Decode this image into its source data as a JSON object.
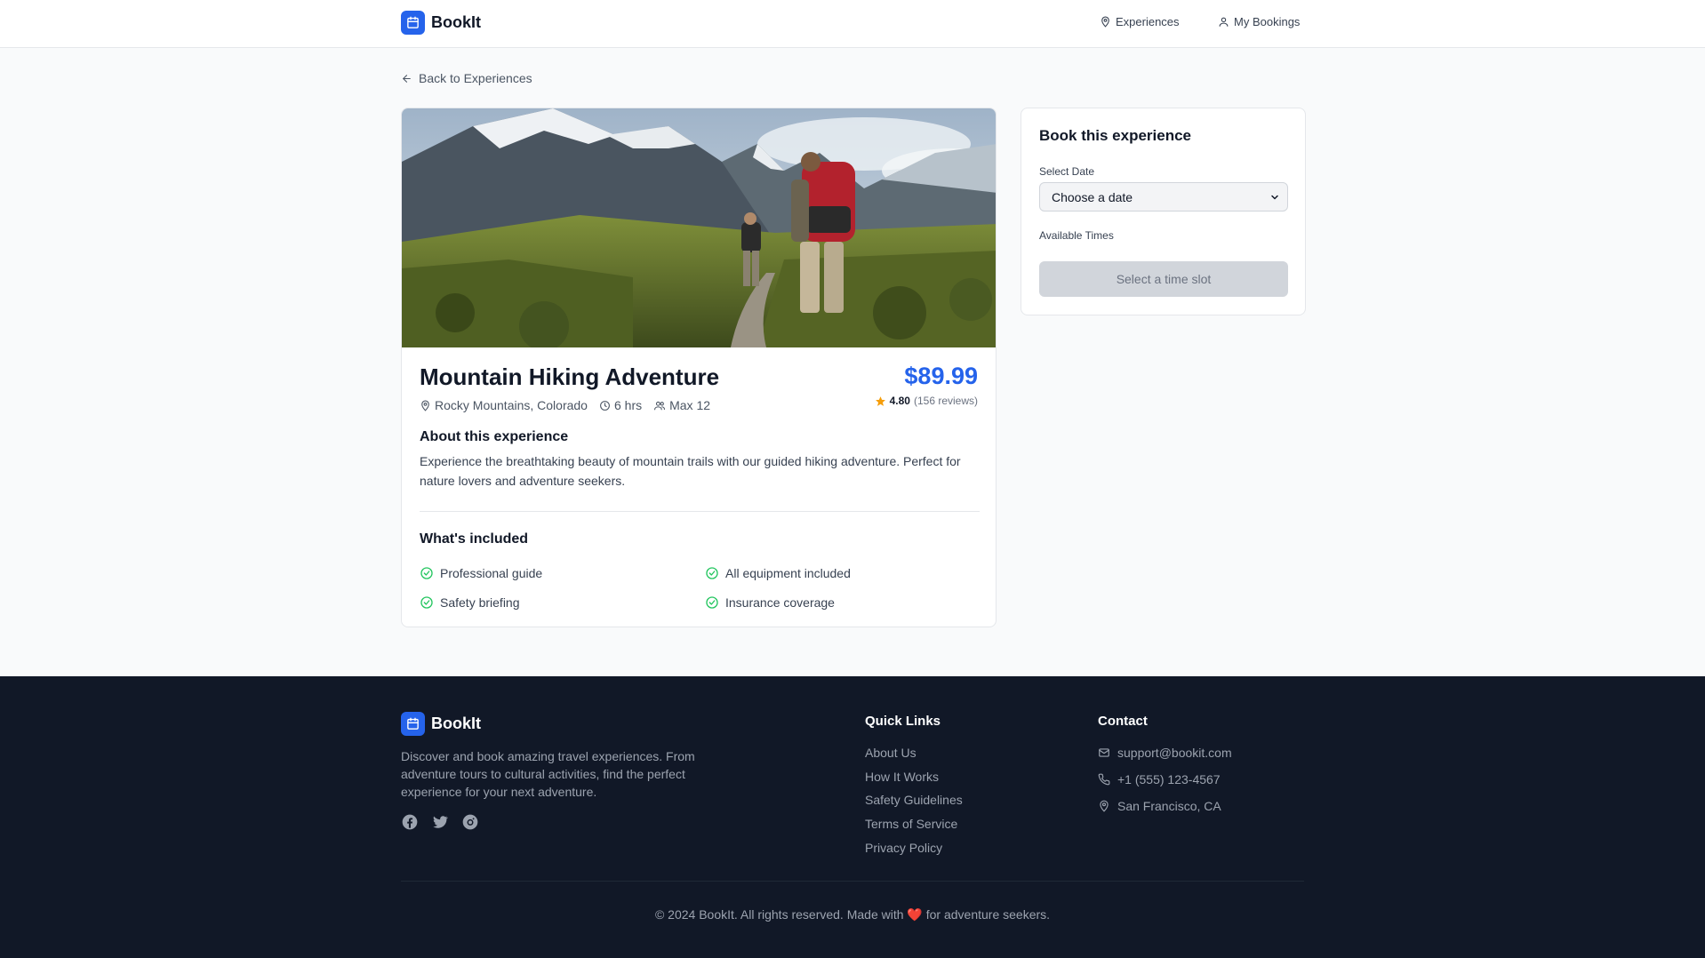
{
  "header": {
    "brand": "BookIt",
    "nav": [
      {
        "label": "Experiences",
        "icon": "map-pin-icon"
      },
      {
        "label": "My Bookings",
        "icon": "user-icon"
      }
    ]
  },
  "back_link": "Back to Experiences",
  "experience": {
    "title": "Mountain Hiking Adventure",
    "location": "Rocky Mountains, Colorado",
    "duration": "6 hrs",
    "capacity": "Max 12",
    "price": "$89.99",
    "rating": "4.80",
    "reviews": "(156 reviews)",
    "about_heading": "About this experience",
    "about_text": "Experience the breathtaking beauty of mountain trails with our guided hiking adventure. Perfect for nature lovers and adventure seekers.",
    "included_heading": "What's included",
    "included": [
      "Professional guide",
      "All equipment included",
      "Safety briefing",
      "Insurance coverage"
    ]
  },
  "booking": {
    "heading": "Book this experience",
    "date_label": "Select Date",
    "date_value": "Choose a date",
    "times_label": "Available Times",
    "slot_button": "Select a time slot"
  },
  "footer": {
    "brand": "BookIt",
    "description": "Discover and book amazing travel experiences. From adventure tours to cultural activities, find the perfect experience for your next adventure.",
    "social": [
      "facebook-icon",
      "twitter-icon",
      "instagram-icon"
    ],
    "quick_links_heading": "Quick Links",
    "quick_links": [
      "About Us",
      "How It Works",
      "Safety Guidelines",
      "Terms of Service",
      "Privacy Policy"
    ],
    "contact_heading": "Contact",
    "contact": {
      "email": "support@bookit.com",
      "phone": "+1 (555) 123-4567",
      "address": "San Francisco, CA"
    },
    "copyright_prefix": "© 2024 BookIt. All rights reserved. Made with",
    "copyright_suffix": "for adventure seekers."
  },
  "colors": {
    "accent": "#2563eb",
    "check": "#22c55e",
    "star": "#f59e0b",
    "footer_bg": "#111827"
  }
}
